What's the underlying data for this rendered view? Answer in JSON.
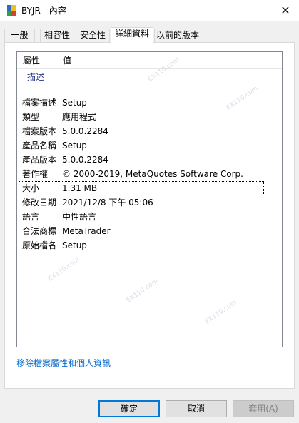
{
  "window": {
    "title": "BYJR - 內容",
    "close_symbol": "✕"
  },
  "tabs": [
    {
      "label": "一般"
    },
    {
      "label": "相容性"
    },
    {
      "label": "安全性"
    },
    {
      "label": "詳細資料"
    },
    {
      "label": "以前的版本"
    }
  ],
  "details": {
    "header_property": "屬性",
    "header_value": "值",
    "group": "描述",
    "rows": [
      {
        "key": "檔案描述",
        "value": "Setup"
      },
      {
        "key": "類型",
        "value": "應用程式"
      },
      {
        "key": "檔案版本",
        "value": "5.0.0.2284"
      },
      {
        "key": "產品名稱",
        "value": "Setup"
      },
      {
        "key": "產品版本",
        "value": "5.0.0.2284"
      },
      {
        "key": "著作權",
        "value": "© 2000-2019, MetaQuotes Software Corp."
      },
      {
        "key": "大小",
        "value": "1.31 MB"
      },
      {
        "key": "修改日期",
        "value": "2021/12/8 下午 05:06"
      },
      {
        "key": "語言",
        "value": "中性語言"
      },
      {
        "key": "合法商標",
        "value": "MetaTrader"
      },
      {
        "key": "原始檔名",
        "value": "Setup"
      }
    ],
    "selected_row": "大小"
  },
  "remove_link": "移除檔案屬性和個人資訊",
  "buttons": {
    "ok": "確定",
    "cancel": "取消",
    "apply": "套用(A)"
  },
  "watermark": "EX110.com"
}
